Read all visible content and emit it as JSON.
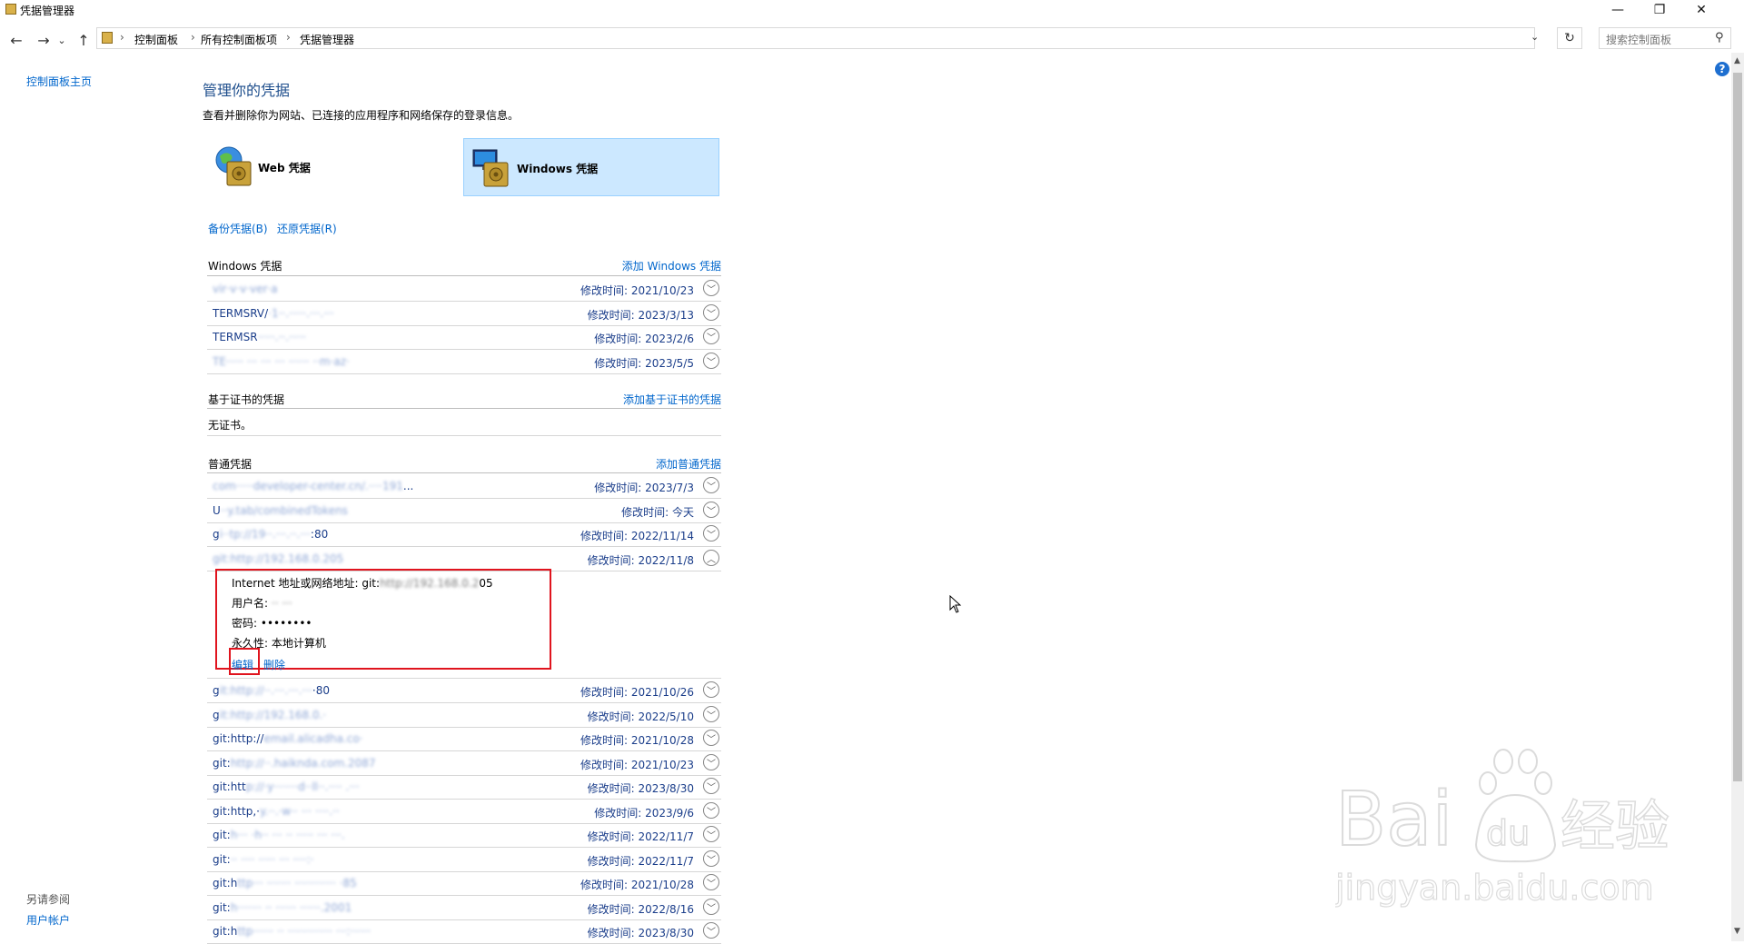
{
  "window": {
    "title": "凭据管理器",
    "minimize_icon": "—",
    "restore_icon": "❐",
    "close_icon": "✕"
  },
  "nav": {
    "back_icon": "←",
    "forward_icon": "→",
    "history_icon": "⌄",
    "up_icon": "↑"
  },
  "breadcrumb": [
    "控制面板",
    "所有控制面板项",
    "凭据管理器"
  ],
  "breadcrumb_sep": "›",
  "search": {
    "placeholder": "搜索控制面板"
  },
  "left_pane": {
    "home": "控制面板主页",
    "see_also": "另请参阅",
    "user_accounts": "用户帐户"
  },
  "main": {
    "title": "管理你的凭据",
    "description": "查看并删除你为网站、已连接的应用程序和网络保存的登录信息。",
    "tiles": {
      "web": "Web 凭据",
      "windows": "Windows 凭据"
    },
    "backup": "备份凭据(B)",
    "restore": "还原凭据(R)"
  },
  "windows_section": {
    "title": "Windows 凭据",
    "add": "添加 Windows 凭据",
    "items": [
      {
        "name_visible": "",
        "name_blur": "vir·v·v·ver·a",
        "date": "修改时间:  2021/10/23"
      },
      {
        "name_visible": "TERMSRV/",
        "name_blur": "·1··.·····.···.···",
        "date": "修改时间:  2023/3/13"
      },
      {
        "name_visible": "TERMSR",
        "name_blur": "·····.··.·····",
        "date": "修改时间:  2023/2/6"
      },
      {
        "name_visible": "",
        "name_blur": "TE····· ··· ··· ··· ······ ··m·az·",
        "date": "修改时间:  2023/5/5"
      }
    ]
  },
  "cert_section": {
    "title": "基于证书的凭据",
    "add": "添加基于证书的凭据",
    "empty": "无证书。"
  },
  "generic_section": {
    "title": "普通凭据",
    "add": "添加普通凭据",
    "items_before": [
      {
        "name_visible": "",
        "name_blur": "com·····developer-center.cn/.····191",
        "name_tail": "...",
        "date": "修改时间:  2023/7/3"
      },
      {
        "name_visible": "U",
        "name_blur": "··y.tab/combinedTokens",
        "name_tail": "",
        "date": "修改时间:  今天"
      },
      {
        "name_visible": "g",
        "name_blur": "i··tp://19··.···.··.···",
        "name_tail": ":80",
        "date": "修改时间:  2022/11/14"
      },
      {
        "name_visible": "",
        "name_blur": "git:http://192.168.0.205",
        "name_tail": "",
        "date": "修改时间:  2022/11/8"
      }
    ],
    "detail": {
      "address_label": "Internet 地址或网络地址:",
      "address_visible": "git:",
      "address_blur": "http://192.168.0.2",
      "address_tail": "05",
      "username_label": "用户名:",
      "username_blur": "·· ···",
      "password_label": "密码:",
      "password_value": "••••••••",
      "persistence_label": "永久性:",
      "persistence_value": "本地计算机",
      "edit": "编辑",
      "delete": "删除"
    },
    "items_after": [
      {
        "name_visible": "g",
        "name_blur": "it:http://··.···.···.···",
        "name_tail": "·80",
        "date": "修改时间:  2021/10/26"
      },
      {
        "name_visible": "g",
        "name_blur": "it:http://192.168.0.·",
        "name_tail": "",
        "date": "修改时间:  2022/5/10"
      },
      {
        "name_visible": "git:http://",
        "name_blur": "email.alicadha.co·",
        "name_tail": "",
        "date": "修改时间:  2021/10/28"
      },
      {
        "name_visible": "git:",
        "name_blur": "http://··.haiknda.com.2087",
        "name_tail": "",
        "date": "修改时间:  2021/10/23"
      },
      {
        "name_visible": "git:htt",
        "name_blur": "p://·y·······d··ll··.···· .···",
        "name_tail": "",
        "date": "修改时间:  2023/8/30"
      },
      {
        "name_visible": "git:http,·",
        "name_blur": "y.··.·w·· ··· ····.··",
        "name_tail": "",
        "date": "修改时间:  2023/9/6"
      },
      {
        "name_visible": "git:",
        "name_blur": "h··· ·h·· ··· ·· ····· ··· ···.",
        "name_tail": "",
        "date": "修改时间:  2022/11/7"
      },
      {
        "name_visible": "git:",
        "name_blur": "·· ···· ····· ··· ····:·",
        "name_tail": "",
        "date": "修改时间:  2022/11/7"
      },
      {
        "name_visible": "git:h",
        "name_blur": "ttp··· ······· ············ ·85",
        "name_tail": "",
        "date": "修改时间:  2021/10/28"
      },
      {
        "name_visible": "git:",
        "name_blur": "h······· ·· ······ ······.2001",
        "name_tail": "",
        "date": "修改时间:  2022/8/16"
      },
      {
        "name_visible": "git:h",
        "name_blur": "ttp······ ·· ············· ···:······",
        "name_tail": "",
        "date": "修改时间:  2023/8/30"
      }
    ]
  },
  "watermark": {
    "brand": "Bai",
    "paw": "du",
    "cn": "经验",
    "url": "jingyan.baidu.com"
  },
  "colors": {
    "link": "#0066cc",
    "title": "#1e4e8c",
    "tile_selected": "#cce8ff",
    "highlight": "#e0141e"
  }
}
